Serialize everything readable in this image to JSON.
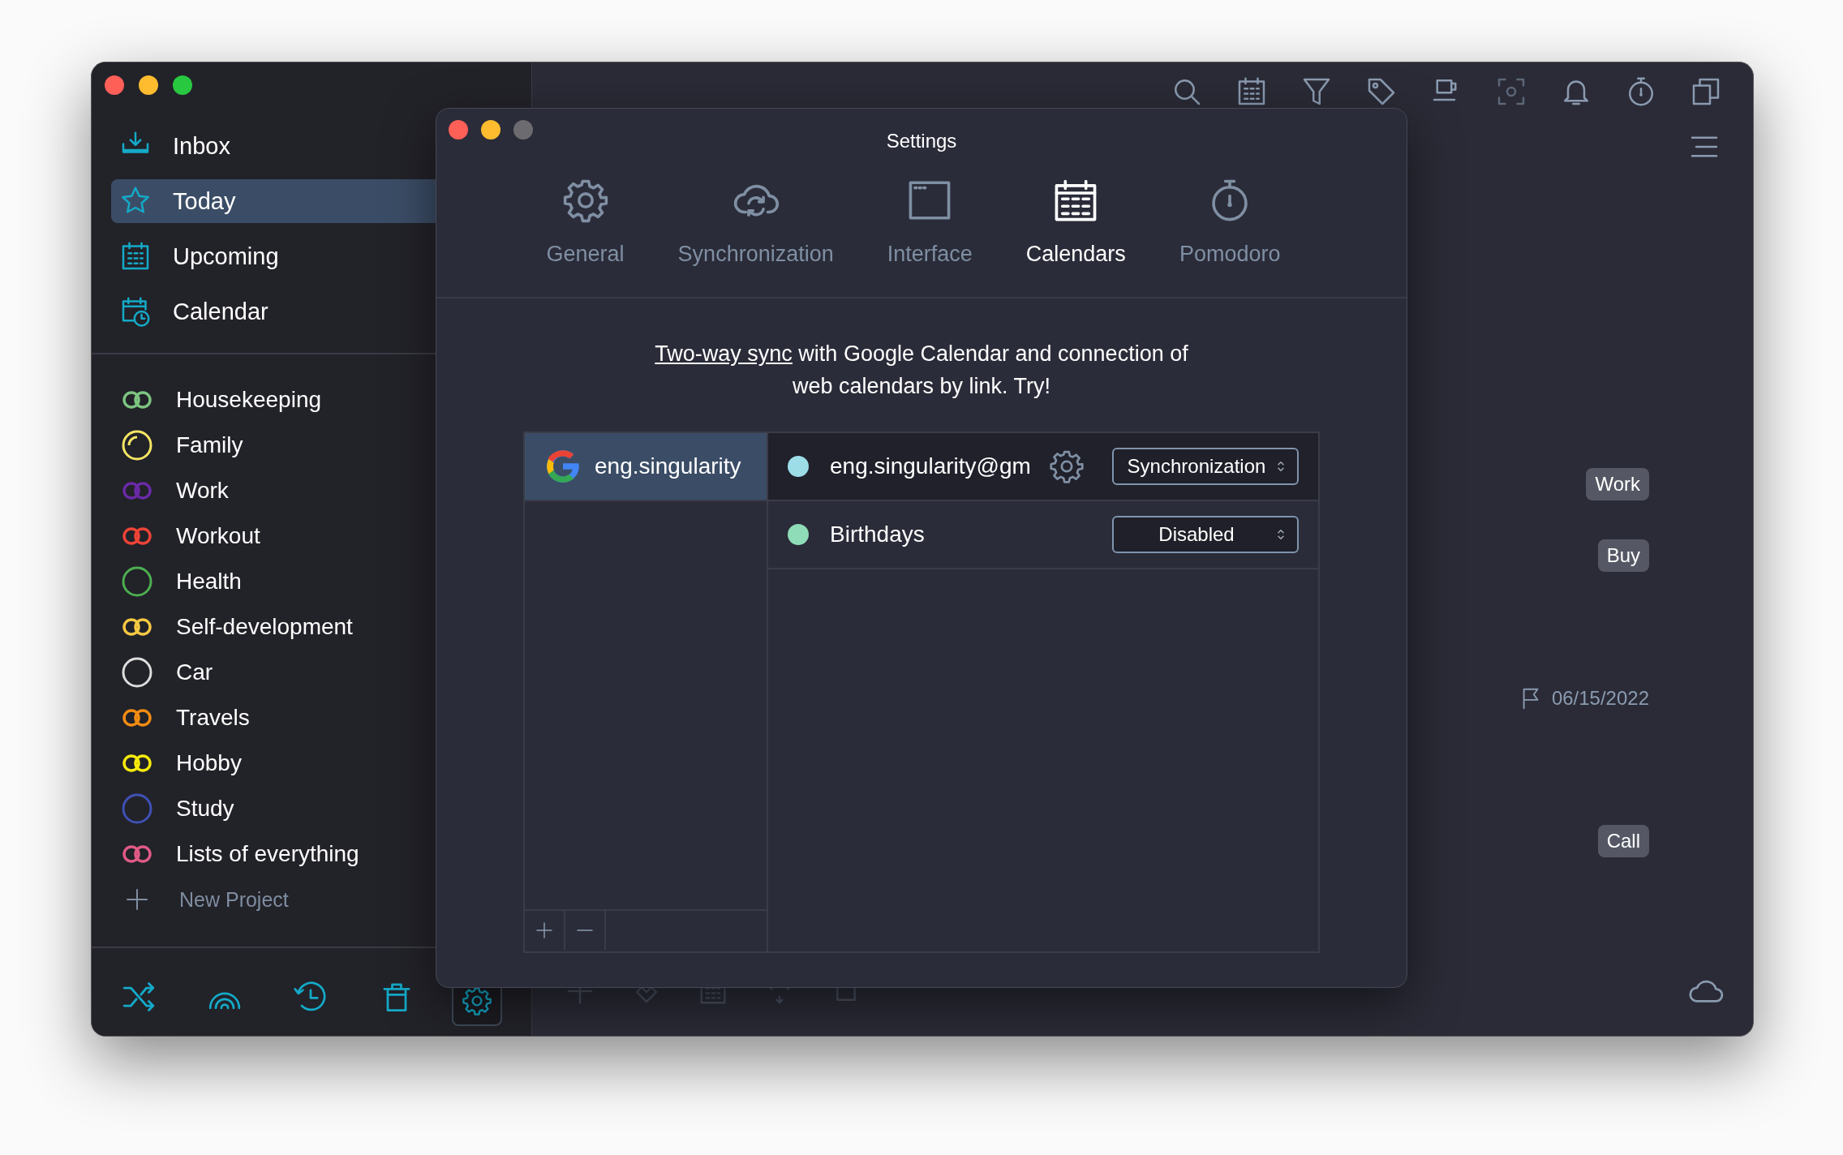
{
  "sidebar": {
    "nav": [
      {
        "label": "Inbox",
        "kind": "inbox",
        "selected": false
      },
      {
        "label": "Today",
        "kind": "star",
        "selected": true
      },
      {
        "label": "Upcoming",
        "kind": "grid",
        "selected": false
      },
      {
        "label": "Calendar",
        "kind": "clock",
        "selected": false
      }
    ],
    "projects": [
      {
        "label": "Housekeeping",
        "kind": "rings",
        "color": "#7cc47f"
      },
      {
        "label": "Family",
        "kind": "progress",
        "color": "#f5e663"
      },
      {
        "label": "Work",
        "kind": "rings",
        "color": "#6a2aa8"
      },
      {
        "label": "Workout",
        "kind": "rings",
        "color": "#ee4437"
      },
      {
        "label": "Health",
        "kind": "circle",
        "color": "#4caf50"
      },
      {
        "label": "Self-development",
        "kind": "rings",
        "color": "#f5c842"
      },
      {
        "label": "Car",
        "kind": "circle",
        "color": "#dddddd"
      },
      {
        "label": "Travels",
        "kind": "rings",
        "color": "#f28c12"
      },
      {
        "label": "Hobby",
        "kind": "rings",
        "color": "#f5ea0c"
      },
      {
        "label": "Study",
        "kind": "circle",
        "color": "#3f51b5"
      },
      {
        "label": "Lists of everything",
        "kind": "rings",
        "color": "#e05a86"
      }
    ],
    "new_project": "New Project"
  },
  "tasks": [
    {
      "kind": "tag",
      "text": "Work"
    },
    {
      "kind": "tag",
      "text": "Buy"
    },
    {
      "kind": "date",
      "text": "06/15/2022"
    },
    {
      "kind": "tag",
      "text": "Call"
    }
  ],
  "settings": {
    "title": "Settings",
    "tabs": [
      {
        "label": "General",
        "kind": "gear",
        "selected": false
      },
      {
        "label": "Synchronization",
        "kind": "cloud",
        "selected": false
      },
      {
        "label": "Interface",
        "kind": "window",
        "selected": false
      },
      {
        "label": "Calendars",
        "kind": "calendar",
        "selected": true
      },
      {
        "label": "Pomodoro",
        "kind": "timer",
        "selected": false
      }
    ],
    "promo": {
      "link": "Two-way sync",
      "text": " with Google Calendar and connection of web calendars by link. Try!"
    },
    "accounts": [
      {
        "label": "eng.singularity",
        "selected": true
      }
    ],
    "calendars": [
      {
        "name": "eng.singularity@gm",
        "color": "#9cdde8",
        "settings": true,
        "mode": "Synchronization",
        "selected": true
      },
      {
        "name": "Birthdays",
        "color": "#8fdcb8",
        "settings": false,
        "mode": "Disabled",
        "selected": false
      }
    ]
  }
}
